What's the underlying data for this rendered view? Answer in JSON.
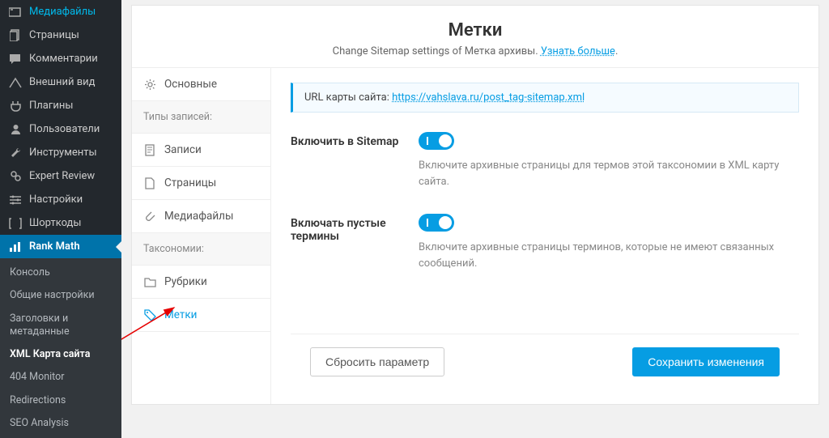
{
  "wp_sidebar": {
    "items": [
      {
        "label": "Медиафайлы",
        "icon": "media"
      },
      {
        "label": "Страницы",
        "icon": "pages"
      },
      {
        "label": "Комментарии",
        "icon": "comments"
      },
      {
        "label": "Внешний вид",
        "icon": "appearance"
      },
      {
        "label": "Плагины",
        "icon": "plugins"
      },
      {
        "label": "Пользователи",
        "icon": "users"
      },
      {
        "label": "Инструменты",
        "icon": "tools"
      },
      {
        "label": "Expert Review",
        "icon": "review"
      },
      {
        "label": "Настройки",
        "icon": "settings"
      },
      {
        "label": "Шорткоды",
        "icon": "shortcodes"
      },
      {
        "label": "Rank Math",
        "icon": "rankmath",
        "active": true
      }
    ],
    "submenu": [
      {
        "label": "Консоль"
      },
      {
        "label": "Общие настройки"
      },
      {
        "label": "Заголовки и метаданные"
      },
      {
        "label": "XML Карта сайта",
        "current": true
      },
      {
        "label": "404 Monitor"
      },
      {
        "label": "Redirections"
      },
      {
        "label": "SEO Analysis"
      }
    ]
  },
  "header": {
    "title": "Метки",
    "subtitle_prefix": "Change Sitemap settings of Метка архивы. ",
    "subtitle_link": "Узнать больше"
  },
  "tabs": [
    {
      "label": "Основные",
      "type": "item",
      "icon": "gear"
    },
    {
      "label": "Типы записей:",
      "type": "group"
    },
    {
      "label": "Записи",
      "type": "item",
      "icon": "doc"
    },
    {
      "label": "Страницы",
      "type": "item",
      "icon": "page"
    },
    {
      "label": "Медиафайлы",
      "type": "item",
      "icon": "clip"
    },
    {
      "label": "Таксономии:",
      "type": "group"
    },
    {
      "label": "Рубрики",
      "type": "item",
      "icon": "folder"
    },
    {
      "label": "Метки",
      "type": "item",
      "icon": "tag",
      "active": true
    }
  ],
  "notice": {
    "prefix": "URL карты сайта: ",
    "url": "https://vahslava.ru/post_tag-sitemap.xml"
  },
  "fields": [
    {
      "label": "Включить в Sitemap",
      "value": true,
      "desc": "Включите архивные страницы для термов этой таксономии в XML карту сайта."
    },
    {
      "label": "Включать пустые термины",
      "value": true,
      "desc": "Включите архивные страницы терминов, которые не имеют связанных сообщений."
    }
  ],
  "footer": {
    "reset": "Сбросить параметр",
    "save": "Сохранить изменения"
  }
}
